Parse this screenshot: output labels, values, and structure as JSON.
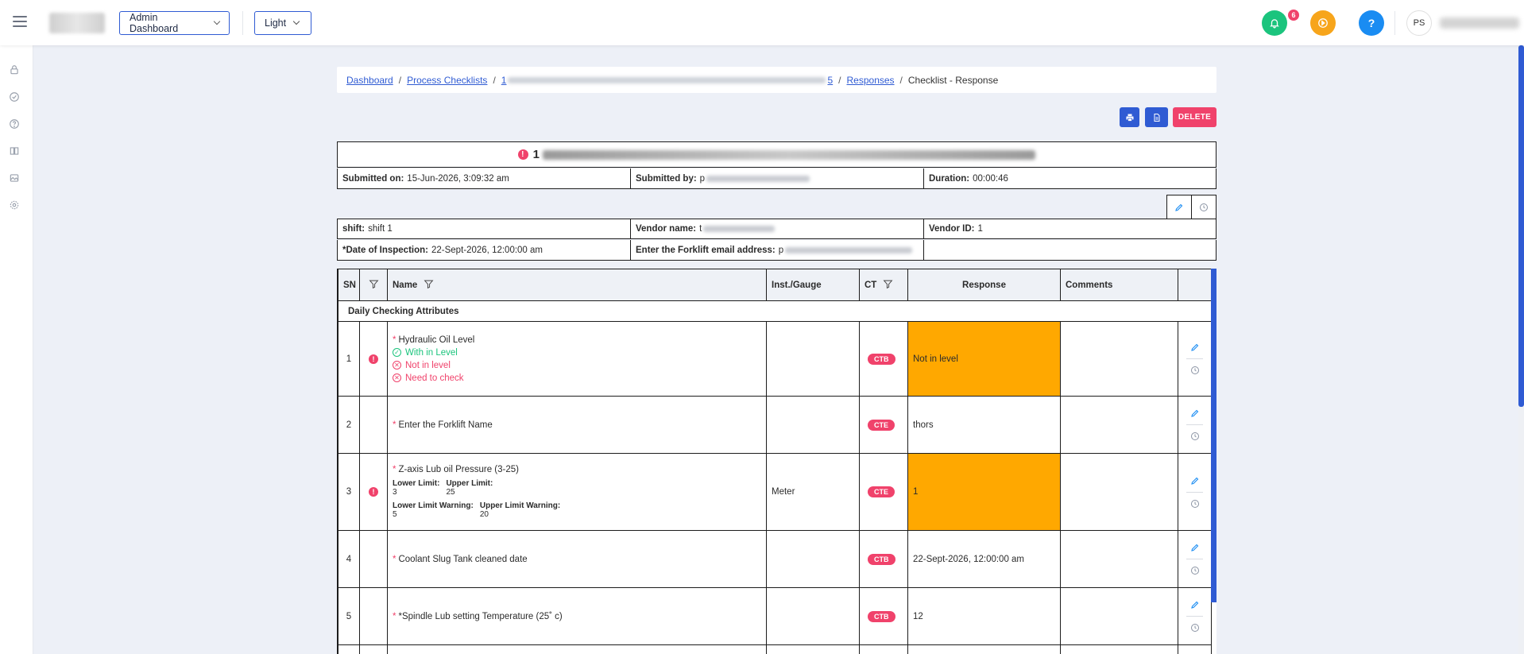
{
  "header": {
    "admin_dropdown": "Admin Dashboard",
    "theme_dropdown": "Light",
    "notification_count": "6",
    "help_label": "?",
    "avatar_initials": "PS"
  },
  "breadcrumb": {
    "dashboard": "Dashboard",
    "process_checklists": "Process Checklists",
    "item_start": "1",
    "item_end": "5",
    "responses": "Responses",
    "current": "Checklist - Response"
  },
  "actions": {
    "delete": "DELETE"
  },
  "checklist": {
    "title_prefix": "1",
    "submitted_on_label": "Submitted on:",
    "submitted_on_value": "15-Jun-2026, 3:09:32 am",
    "submitted_by_label": "Submitted by:",
    "submitted_by_value": "p",
    "duration_label": "Duration:",
    "duration_value": "00:00:46",
    "shift_label": "shift:",
    "shift_value": "shift 1",
    "vendor_name_label": "Vendor name:",
    "vendor_name_value": "t",
    "vendor_id_label": "Vendor ID:",
    "vendor_id_value": "1",
    "date_label": "*Date of Inspection:",
    "date_value": "22-Sept-2026, 12:00:00 am",
    "email_label": "Enter the Forklift email address:",
    "email_value": "p"
  },
  "table": {
    "headers": {
      "sn": "SN",
      "name": "Name",
      "inst": "Inst./Gauge",
      "ct": "CT",
      "response": "Response",
      "comments": "Comments"
    },
    "section": "Daily Checking Attributes",
    "rows": [
      {
        "sn": "1",
        "name": "Hydraulic Oil Level",
        "options": [
          "With in Level",
          "Not in level",
          "Need to check"
        ],
        "inst": "",
        "ct": "CTB",
        "response": "Not in level"
      },
      {
        "sn": "2",
        "name": "Enter the Forklift Name",
        "inst": "",
        "ct": "CTE",
        "response": "thors"
      },
      {
        "sn": "3",
        "name": "Z-axis Lub oil Pressure (3-25)",
        "lower_limit_label": "Lower Limit:",
        "lower_limit": "3",
        "upper_limit_label": "Upper Limit:",
        "upper_limit": "25",
        "lower_warn_label": "Lower Limit Warning:",
        "lower_warn": "5",
        "upper_warn_label": "Upper Limit Warning:",
        "upper_warn": "20",
        "inst": "Meter",
        "ct": "CTE",
        "response": "1"
      },
      {
        "sn": "4",
        "name": "Coolant Slug Tank cleaned date",
        "inst": "",
        "ct": "CTB",
        "response": "22-Sept-2026, 12:00:00 am"
      },
      {
        "sn": "5",
        "name": "*Spindle Lub setting Temperature (25˚ c)",
        "inst": "",
        "ct": "CTB",
        "response": "12"
      }
    ]
  },
  "colors": {
    "primary": "#2f5bd3",
    "danger": "#f0426b",
    "highlight": "#ffa800",
    "success": "#1bc47d"
  }
}
